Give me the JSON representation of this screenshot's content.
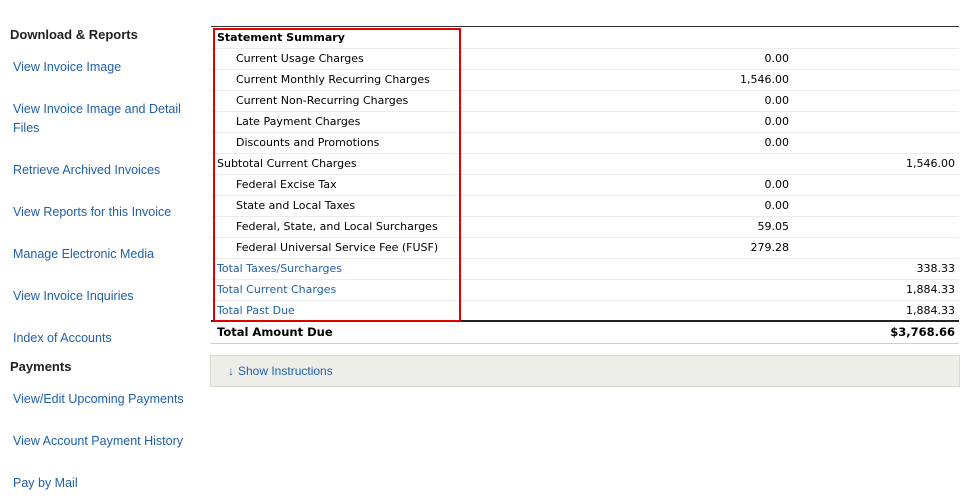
{
  "sidebar": {
    "download_heading": "Download & Reports",
    "download_links": [
      "View Invoice Image",
      "View Invoice Image and Detail Files",
      "Retrieve Archived Invoices",
      "View Reports for this Invoice",
      "Manage Electronic Media",
      "View Invoice Inquiries",
      "Index of Accounts"
    ],
    "payments_heading": "Payments",
    "payment_links": [
      "View/Edit Upcoming Payments",
      "View Account Payment History",
      "Pay by Mail"
    ]
  },
  "statement": {
    "title": "Statement Summary",
    "rows": [
      {
        "label": "Current Usage Charges",
        "amount": "0.00",
        "total": ""
      },
      {
        "label": "Current Monthly Recurring Charges",
        "amount": "1,546.00",
        "total": ""
      },
      {
        "label": "Current Non-Recurring Charges",
        "amount": "0.00",
        "total": ""
      },
      {
        "label": "Late Payment Charges",
        "amount": "0.00",
        "total": ""
      },
      {
        "label": "Discounts and Promotions",
        "amount": "0.00",
        "total": ""
      },
      {
        "label": "Subtotal Current Charges",
        "amount": "",
        "total": "1,546.00"
      },
      {
        "label": "Federal Excise Tax",
        "amount": "0.00",
        "total": ""
      },
      {
        "label": "State and Local Taxes",
        "amount": "0.00",
        "total": ""
      },
      {
        "label": "Federal, State, and Local Surcharges",
        "amount": "59.05",
        "total": ""
      },
      {
        "label": "Federal Universal Service Fee (FUSF)",
        "amount": "279.28",
        "total": ""
      },
      {
        "label": "Total Taxes/Surcharges",
        "amount": "",
        "total": "338.33"
      },
      {
        "label": "Total Current Charges",
        "amount": "",
        "total": "1,884.33"
      },
      {
        "label": "Total Past Due",
        "amount": "",
        "total": "1,884.33"
      }
    ],
    "total_label": "Total Amount Due",
    "total_value": "$3,768.66"
  },
  "instructions": {
    "arrow": "↓",
    "label": "Show Instructions"
  },
  "colors": {
    "link": "#1f5fa8",
    "highlight": "#e00000",
    "instructions_bg": "#eeeee8"
  }
}
